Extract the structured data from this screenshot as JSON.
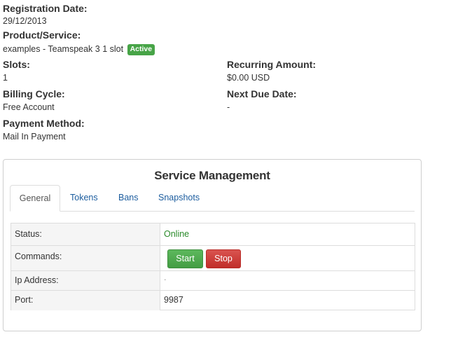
{
  "details": {
    "registration_date_label": "Registration Date:",
    "registration_date_value": "29/12/2013",
    "product_label": "Product/Service:",
    "product_value": "examples - Teamspeak 3 1 slot",
    "product_status": "Active",
    "slots_label": "Slots:",
    "slots_value": "1",
    "recurring_label": "Recurring Amount:",
    "recurring_value": "$0.00 USD",
    "billing_label": "Billing Cycle:",
    "billing_value": "Free Account",
    "next_due_label": "Next Due Date:",
    "next_due_value": "-",
    "payment_label": "Payment Method:",
    "payment_value": "Mail In Payment"
  },
  "service_management": {
    "title": "Service Management",
    "tabs": [
      {
        "label": "General",
        "active": true
      },
      {
        "label": "Tokens",
        "active": false
      },
      {
        "label": "Bans",
        "active": false
      },
      {
        "label": "Snapshots",
        "active": false
      }
    ],
    "rows": {
      "status_label": "Status:",
      "status_value": "Online",
      "commands_label": "Commands:",
      "start_label": "Start",
      "stop_label": "Stop",
      "ip_label": "Ip Address:",
      "ip_value": ".",
      "port_label": "Port:",
      "port_value": "9987"
    }
  },
  "colors": {
    "active_badge": "#47a447",
    "online_text": "#2a8a2a",
    "start_button": "#5cb85c",
    "stop_button": "#d9534f",
    "tab_link": "#1b5c9e"
  }
}
